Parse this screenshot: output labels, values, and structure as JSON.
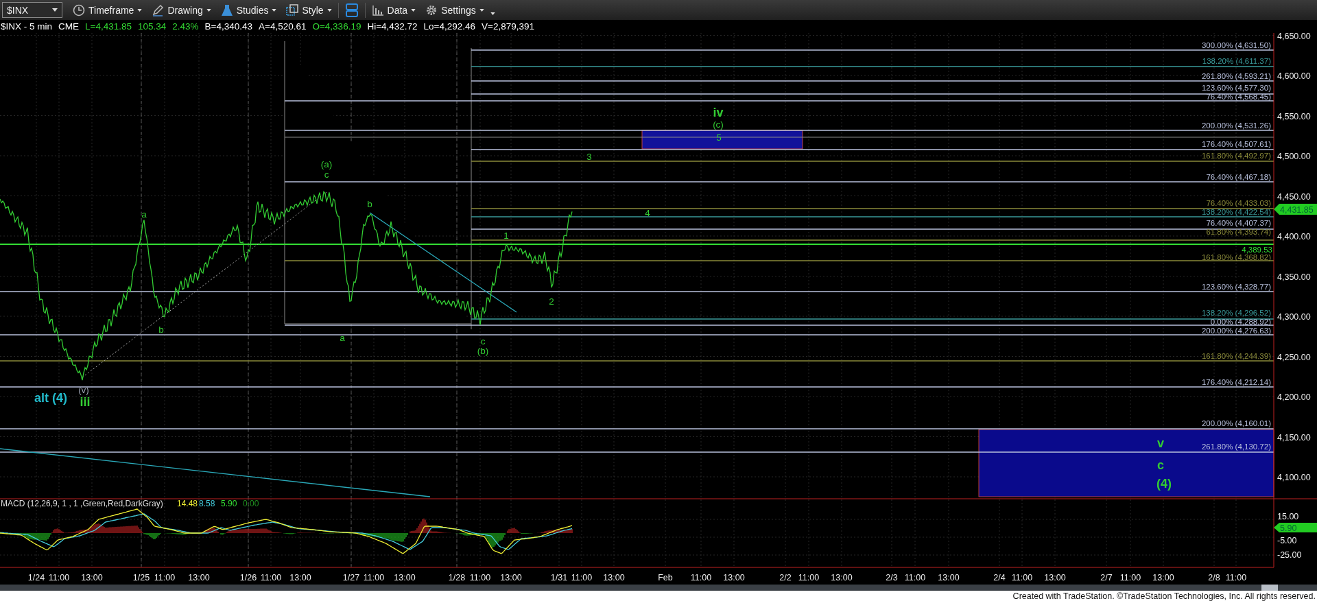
{
  "toolbar": {
    "symbol": "$INX",
    "menus": [
      {
        "kind": "timeframe",
        "label": "Timeframe"
      },
      {
        "kind": "drawing",
        "label": "Drawing"
      },
      {
        "kind": "studies",
        "label": "Studies"
      },
      {
        "kind": "style",
        "label": "Style"
      },
      {
        "kind": "layout"
      },
      {
        "kind": "data",
        "label": "Data"
      },
      {
        "kind": "settings",
        "label": "Settings"
      }
    ]
  },
  "info": [
    {
      "text": "$INX - 5 min",
      "color": "#ffffff"
    },
    {
      "text": "CME",
      "color": "#ffffff"
    },
    {
      "text": "L=4,431.85",
      "color": "#33dd33"
    },
    {
      "text": "105.34",
      "color": "#33dd33"
    },
    {
      "text": "2.43%",
      "color": "#33dd33"
    },
    {
      "text": "B=4,340.43",
      "color": "#ffffff"
    },
    {
      "text": "A=4,520.61",
      "color": "#ffffff"
    },
    {
      "text": "O=4,336.19",
      "color": "#33dd33"
    },
    {
      "text": "Hi=4,432.72",
      "color": "#ffffff"
    },
    {
      "text": "Lo=4,292.46",
      "color": "#ffffff"
    },
    {
      "text": "V=2,879,391",
      "color": "#ffffff"
    }
  ],
  "fib_labels": [
    {
      "text": "300.00% (4,631.50)",
      "color": "#b8c0dc"
    },
    {
      "text": "138.20% (4,611.37)",
      "color": "#3a9a9a"
    },
    {
      "text": "261.80% (4,593.21)",
      "color": "#b8c0dc"
    },
    {
      "text": "123.60% (4,577.30)",
      "color": "#b8c0dc"
    },
    {
      "text": "76.40% (4,568.45)",
      "color": "#b8c0dc"
    },
    {
      "text": "200.00% (4,531.26)",
      "color": "#b8c0dc"
    },
    {
      "text": "176.40% (4,507.61)",
      "color": "#b8c0dc"
    },
    {
      "text": "161.80% (4,492.97)",
      "color": "#8a8a3a"
    },
    {
      "text": "76.40% (4,467.18)",
      "color": "#b8c0dc"
    },
    {
      "text": "76.40% (4,433.03)",
      "color": "#8a8a3a"
    },
    {
      "text": "138.20% (4,422.54)",
      "color": "#3a9a9a"
    },
    {
      "text": "76.40% (4,407.37)",
      "color": "#b8c0dc"
    },
    {
      "text": "61.80% (4,393.74)",
      "color": "#8a8a3a"
    },
    {
      "text": "161.80% (4,368.82)",
      "color": "#8a8a3a"
    },
    {
      "text": "123.60% (4,328.77)",
      "color": "#b8c0dc"
    },
    {
      "text": "138.20% (4,296.52)",
      "color": "#3a9a9a"
    },
    {
      "text": "0.00% (4,288.92)",
      "color": "#b8c0dc"
    },
    {
      "text": "200.00% (4,276.63)",
      "color": "#b8c0dc"
    },
    {
      "text": "161.80% (4,244.39)",
      "color": "#8a8a3a"
    },
    {
      "text": "176.40% (4,212.14)",
      "color": "#b8c0dc"
    },
    {
      "text": "200.00% (4,160.01)",
      "color": "#b8c0dc"
    },
    {
      "text": "261.80% (4,130.72)",
      "color": "#b8c0dc"
    }
  ],
  "wave_labels": [
    {
      "text": "iv",
      "kind": "major",
      "color": "#33cc33"
    },
    {
      "text": "(c)",
      "kind": "minor",
      "color": "#33cc33"
    },
    {
      "text": "5",
      "kind": "minor",
      "color": "#33cc33"
    },
    {
      "text": "3",
      "kind": "minor",
      "color": "#33cc33"
    },
    {
      "text": "4",
      "kind": "minor",
      "color": "#33cc33"
    },
    {
      "text": "1",
      "kind": "minor",
      "color": "#33cc33"
    },
    {
      "text": "2",
      "kind": "minor",
      "color": "#33cc33"
    },
    {
      "text": "(a)",
      "kind": "minor",
      "color": "#33cc33"
    },
    {
      "text": "c",
      "kind": "minor",
      "color": "#33cc33"
    },
    {
      "text": "b",
      "kind": "minor",
      "color": "#33cc33"
    },
    {
      "text": "a",
      "kind": "minor",
      "color": "#33cc33"
    },
    {
      "text": "b",
      "kind": "minor",
      "color": "#33cc33"
    },
    {
      "text": "a",
      "kind": "minor",
      "color": "#33cc33"
    },
    {
      "text": "c",
      "kind": "minor",
      "color": "#33cc33"
    },
    {
      "text": "(b)",
      "kind": "minor",
      "color": "#33cc33"
    },
    {
      "text": "(v)",
      "kind": "minor",
      "color": "#9aa0b0"
    },
    {
      "text": "iii",
      "kind": "major",
      "color": "#33cc33"
    },
    {
      "text": "alt (4)",
      "kind": "major",
      "color": "#22bbcc"
    },
    {
      "text": "v",
      "kind": "major",
      "color": "#33cc33"
    },
    {
      "text": "c",
      "kind": "major",
      "color": "#33cc33"
    },
    {
      "text": "(4)",
      "kind": "major",
      "color": "#33cc33"
    }
  ],
  "price_axis": [
    "4,650.00",
    "4,600.00",
    "4,550.00",
    "4,500.00",
    "4,450.00",
    "4,400.00",
    "4,350.00",
    "4,300.00",
    "4,250.00",
    "4,200.00",
    "4,150.00",
    "4,100.00"
  ],
  "last_price": "4,431.85",
  "line_value": "4,389.53",
  "macd": {
    "legend": "MACD (12,26,9, 1 , 1 ,Green,Red,DarkGray)",
    "values": [
      {
        "text": "14.48",
        "color": "#eeee33"
      },
      {
        "text": "8.58",
        "color": "#44ccdd"
      },
      {
        "text": "5.90",
        "color": "#33dd33"
      },
      {
        "text": "0.00",
        "color": "#1f8f1f"
      }
    ],
    "axis": [
      "15.00",
      "-5.00",
      "-25.00"
    ],
    "last": "5.90"
  },
  "time_axis": [
    "1/24",
    "11:00",
    "13:00",
    "1/25",
    "11:00",
    "13:00",
    "1/26",
    "11:00",
    "13:00",
    "1/27",
    "11:00",
    "13:00",
    "1/28",
    "11:00",
    "13:00",
    "1/31",
    "11:00",
    "13:00",
    "Feb",
    "11:00",
    "13:00",
    "2/2",
    "11:00",
    "13:00",
    "2/3",
    "11:00",
    "13:00",
    "2/4",
    "11:00",
    "13:00",
    "2/7",
    "11:00",
    "13:00",
    "2/8",
    "11:00"
  ],
  "footer": "Created with TradeStation. ©TradeStation Technologies, Inc. All rights reserved."
}
